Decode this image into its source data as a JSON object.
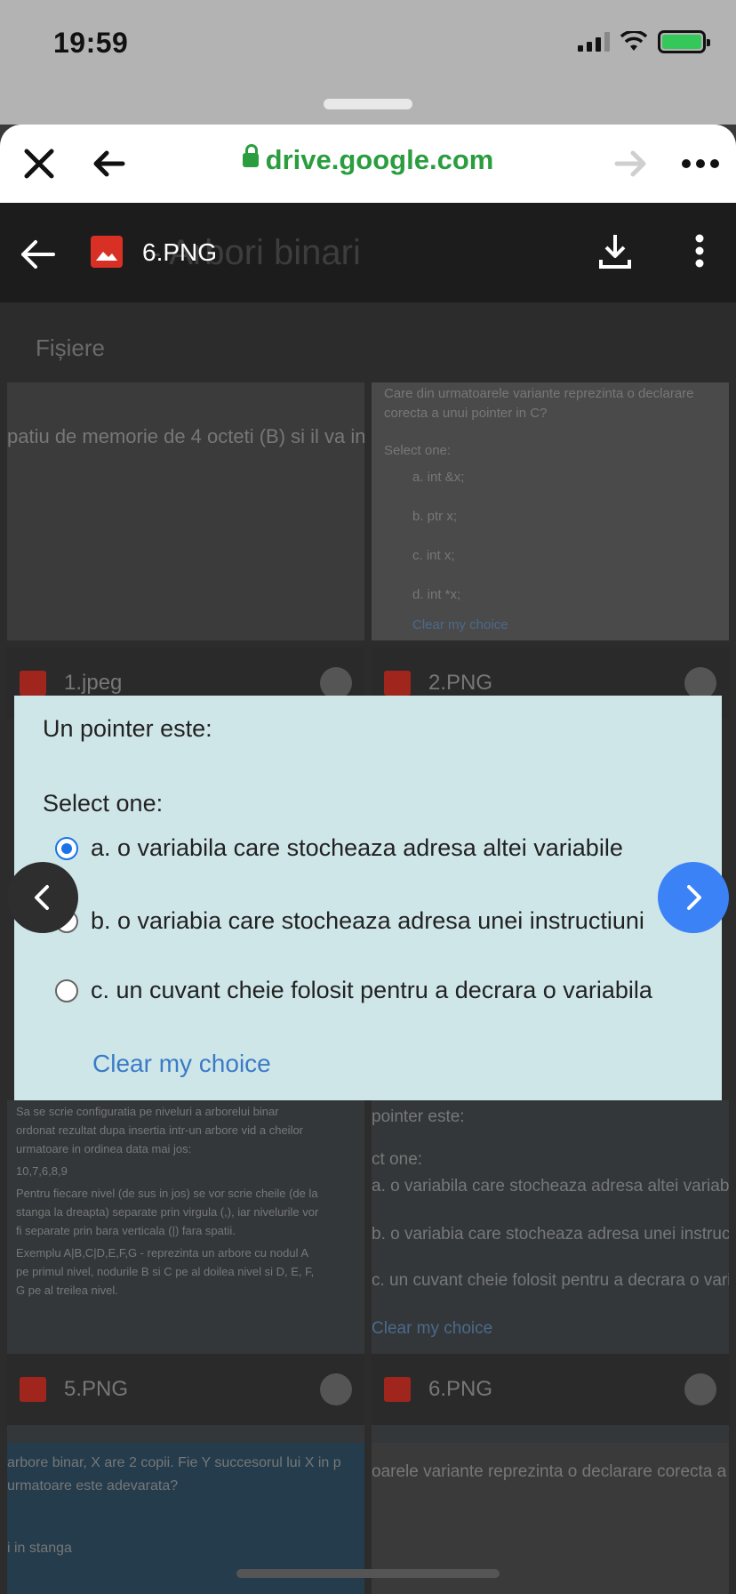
{
  "status_bar": {
    "time": "19:59"
  },
  "browser": {
    "url": "drive.google.com"
  },
  "drive_header": {
    "file_title": "6.PNG",
    "background_title": "- Arbori binari"
  },
  "background": {
    "section_label": "Fișiere",
    "tile_top_left_text": "patiu de memorie de 4 octeti (B) si il va in",
    "tile_top_right": {
      "question": "Care din urmatoarele variante reprezinta o declarare corecta a unui pointer in C?",
      "select": "Select one:",
      "options": [
        "a. int &x;",
        "b. ptr x;",
        "c. int x;",
        "d. int *x;"
      ],
      "clear": "Clear my choice"
    },
    "tiles_row1": [
      "1.jpeg",
      "2.PNG"
    ],
    "tile_mid_left_lines": [
      "Sa se scrie configuratia pe niveluri a arborelui binar",
      "ordonat rezultat dupa insertia intr-un arbore vid a cheilor",
      "urmatoare in ordinea data mai jos:",
      "10,7,6,8,9",
      "Pentru fiecare nivel (de sus in jos) se vor scrie cheile (de la",
      "stanga la dreapta) separate prin virgula (,), iar nivelurile vor",
      "fi separate prin bara verticala (|) fara spatii.",
      "Exemplu A|B,C|D,E,F,G - reprezinta un arbore cu nodul A",
      "pe primul nivel, nodurile B si C pe al doilea nivel si D, E, F,",
      "G pe al treilea nivel."
    ],
    "tile_mid_right": {
      "question": "pointer este:",
      "select": "ct one:",
      "options": [
        "a. o variabila care stocheaza adresa altei variabile",
        "b. o variabia care stocheaza adresa unei instructiuni",
        "c. un cuvant cheie folosit pentru a decrara o variabila"
      ],
      "clear": "Clear my choice"
    },
    "tiles_row2": [
      "5.PNG",
      "6.PNG"
    ],
    "tile_bottom_left_lines": [
      "arbore binar, X are 2 copii. Fie Y succesorul lui X in p",
      "urmatoare este adevarata?",
      "",
      "",
      "i in stanga"
    ],
    "tile_bottom_right_text": "oarele variante reprezinta o declarare corecta a"
  },
  "preview": {
    "question": "Un pointer este:",
    "select_label": "Select one:",
    "options": [
      {
        "label": "a. o variabila care stocheaza adresa altei variabile",
        "selected": true
      },
      {
        "label": "b. o variabia care stocheaza adresa unei instructiuni",
        "selected": false
      },
      {
        "label": "c. un cuvant cheie folosit pentru a decrara o variabila",
        "selected": false
      }
    ],
    "clear_label": "Clear my choice"
  },
  "colors": {
    "url_green": "#2a9d3f",
    "link_blue": "#3b7bc6",
    "radio_blue": "#1a73e8",
    "next_button": "#3b82f6",
    "preview_bg": "#cfe6e9"
  },
  "icons": [
    "close-icon",
    "back-arrow-icon",
    "lock-icon",
    "forward-arrow-icon",
    "more-horizontal-icon",
    "image-file-icon",
    "download-icon",
    "more-vertical-icon",
    "chevron-left-icon",
    "chevron-right-icon",
    "info-icon"
  ]
}
